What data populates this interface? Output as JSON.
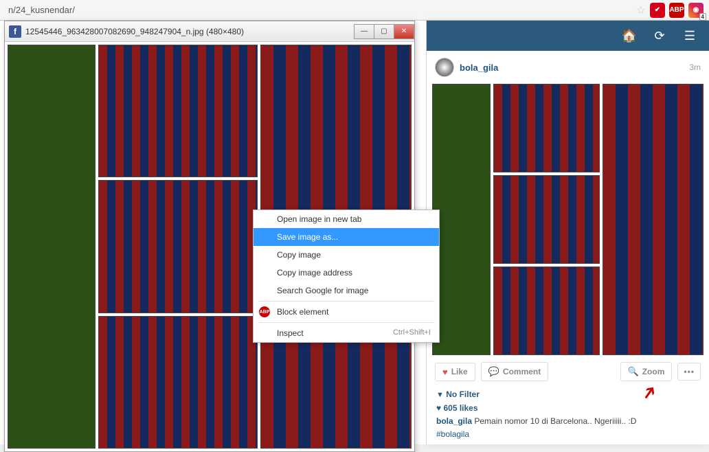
{
  "browser": {
    "url": "n/24_kusnendar/",
    "ext_badge": "4"
  },
  "image_window": {
    "title": "12545446_963428007082690_948247904_n.jpg (480×480)"
  },
  "context_menu": {
    "open_new_tab": "Open image in new tab",
    "save_as": "Save image as...",
    "copy_image": "Copy image",
    "copy_address": "Copy image address",
    "search_google": "Search Google for image",
    "block_element": "Block element",
    "inspect": "Inspect",
    "inspect_shortcut": "Ctrl+Shift+I"
  },
  "instagram": {
    "username": "bola_gila",
    "time_ago": "3m",
    "actions": {
      "like": "Like",
      "comment": "Comment",
      "zoom": "Zoom"
    },
    "filter_label": "No Filter",
    "likes_count": "605 likes",
    "caption_user": "bola_gila",
    "caption_text": "Pemain nomor 10 di Barcelona.. Ngeriiiii.. :D",
    "hashtag": "#bolagila"
  }
}
